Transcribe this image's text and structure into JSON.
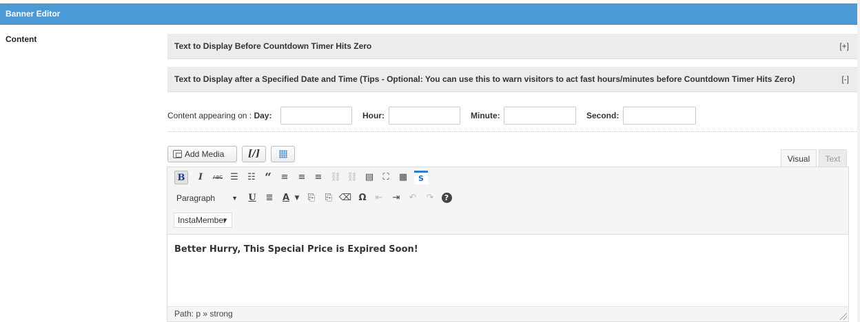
{
  "header": {
    "title": "Banner Editor"
  },
  "content_label": "Content",
  "accordions": [
    {
      "title": "Text to Display Before Countdown Timer Hits Zero",
      "toggle": "[+]"
    },
    {
      "title": "Text to Display after a Specified Date and Time (Tips - Optional: You can use this to warn visitors to act fast hours/minutes before Countdown Timer Hits Zero)",
      "toggle": "[-]"
    }
  ],
  "schedule": {
    "prefix": "Content appearing on :",
    "day_label": "Day:",
    "hour_label": "Hour:",
    "minute_label": "Minute:",
    "second_label": "Second:",
    "day_value": "",
    "hour_value": "",
    "minute_value": "",
    "second_value": ""
  },
  "media_buttons": {
    "add_media": "Add Media",
    "shortcode": "[/]"
  },
  "tabs": {
    "visual": "Visual",
    "text": "Text"
  },
  "toolbar": {
    "bold": "B",
    "italic": "I",
    "strikethrough": "ABC",
    "blockquote": "“",
    "format_select": "Paragraph",
    "underline": "U",
    "textcolor": "A",
    "special_char": "Ω",
    "undo": "↶",
    "redo": "↷",
    "help": "?",
    "plugin_select": "InstaMember",
    "s_button": "S"
  },
  "editor": {
    "content": "Better Hurry, This Special Price is Expired Soon!"
  },
  "status": {
    "path_label": "Path: p » strong"
  },
  "colors": {
    "header_bg": "#4b9ad5",
    "accent_blue": "#3b8ed0"
  }
}
